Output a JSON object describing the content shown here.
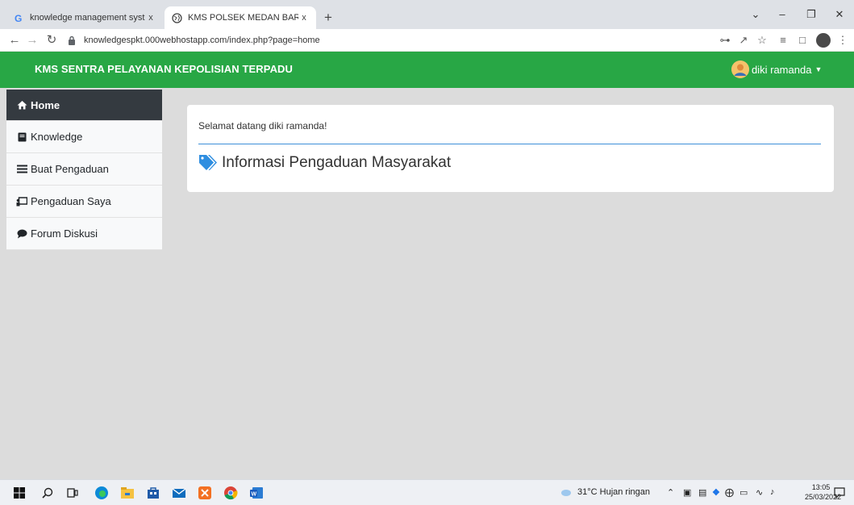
{
  "browser": {
    "tabs": [
      {
        "title": "knowledge management system",
        "close": "x",
        "favicon": "google-icon"
      },
      {
        "title": "KMS POLSEK MEDAN BARAT",
        "close": "x",
        "favicon": "globe-icon"
      }
    ],
    "new_tab": "+",
    "url": "knowledgespkt.000webhostapp.com/index.php?page=home"
  },
  "app": {
    "brand": "KMS SENTRA PELAYANAN KEPOLISIAN TERPADU",
    "user": "diki ramanda",
    "colors": {
      "navbar": "#28a745",
      "active_sidebar": "#343a40",
      "accent": "#3d8fd9"
    }
  },
  "sidebar": {
    "items": [
      {
        "label": "Home",
        "icon": "home-icon",
        "active": true
      },
      {
        "label": "Knowledge",
        "icon": "book-icon",
        "active": false
      },
      {
        "label": "Buat Pengaduan",
        "icon": "list-icon",
        "active": false
      },
      {
        "label": "Pengaduan Saya",
        "icon": "chalkboard-icon",
        "active": false
      },
      {
        "label": "Forum Diskusi",
        "icon": "comment-icon",
        "active": false
      }
    ]
  },
  "main": {
    "welcome": "Selamat datang diki ramanda!",
    "section_title": "Informasi Pengaduan Masyarakat"
  },
  "taskbar": {
    "weather": "31°C  Hujan ringan",
    "time": "13:05",
    "date": "25/03/2022"
  }
}
